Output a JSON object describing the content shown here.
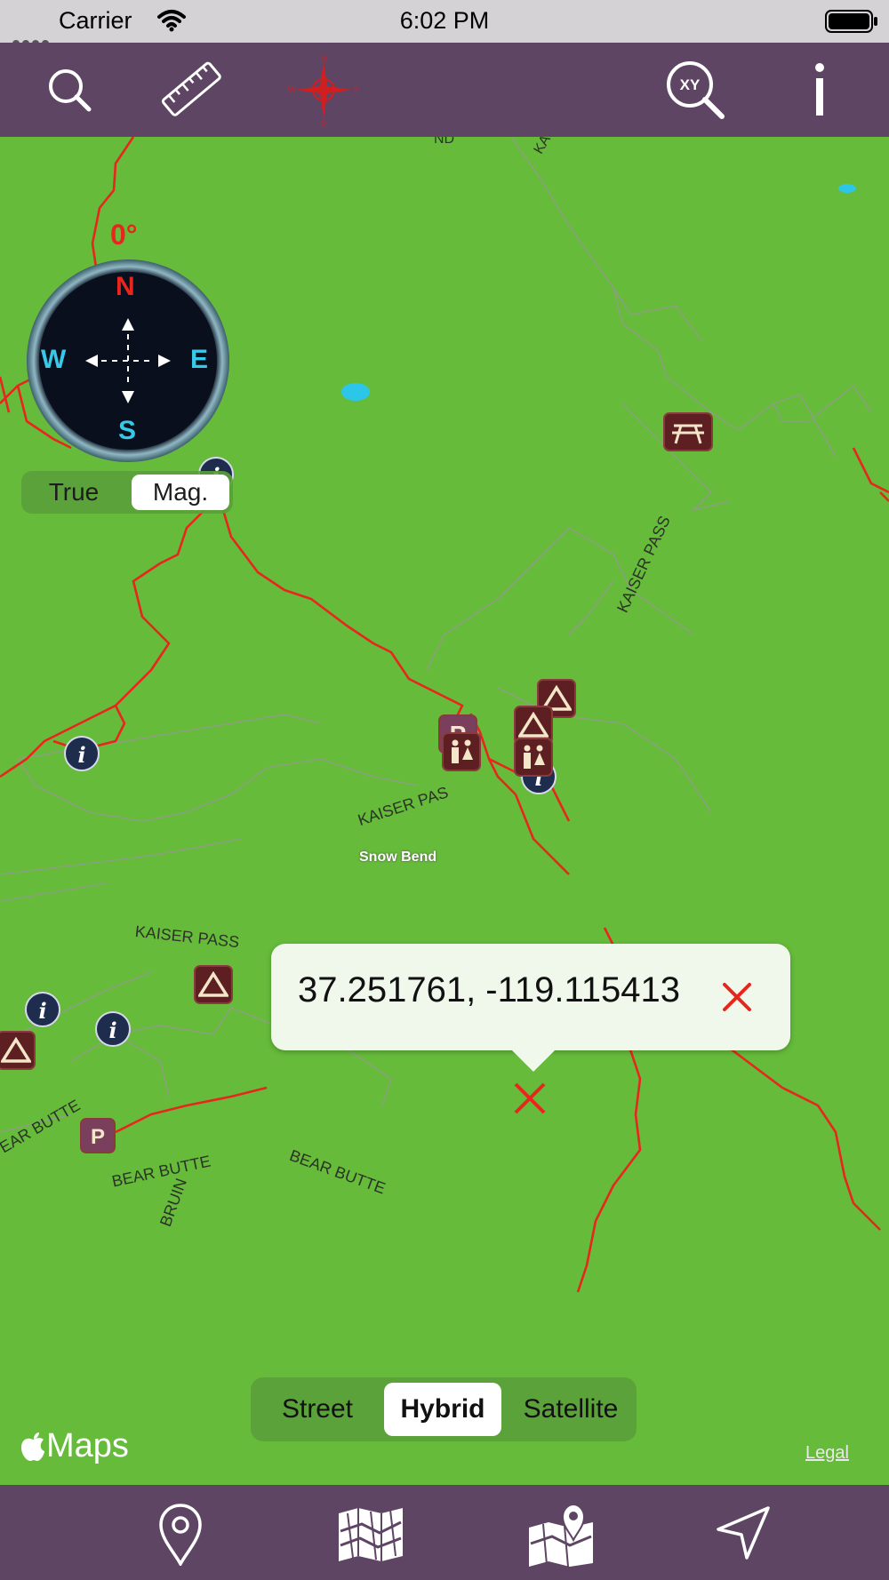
{
  "status_bar": {
    "carrier": "Carrier",
    "time": "6:02 PM",
    "icons": [
      "signal-dots-icon",
      "wifi-icon",
      "battery-icon"
    ]
  },
  "toolbar": {
    "items": [
      {
        "name": "search",
        "icon": "search-icon"
      },
      {
        "name": "ruler",
        "icon": "ruler-icon"
      },
      {
        "name": "compass-rose",
        "icon": "compass-rose-icon"
      },
      {
        "name": "xy-search",
        "icon": "xy-search-icon"
      },
      {
        "name": "info",
        "icon": "info-icon"
      }
    ]
  },
  "compass": {
    "degree": "0°",
    "north": "N",
    "south": "S",
    "east": "E",
    "west": "W",
    "toggle": {
      "options": [
        "True",
        "Mag."
      ],
      "selected": "Mag."
    }
  },
  "map": {
    "labels": {
      "kaiser_pass_1": "KAISER PASS",
      "kaiser_pass_2": "KAISER PASS",
      "kaiser_pass_3": "KAISER PAS",
      "snow_bend": "Snow Bend",
      "bear_butte_1": "BEAR BUTTE",
      "bear_butte_2": "BEAR BUTTE",
      "bear_butte_3": "EAR BUTTE",
      "bruin": "BRUIN",
      "top_fragment_1": "ND",
      "top_fragment_2": "KA"
    }
  },
  "callout": {
    "coordinates": "37.251761, -119.115413"
  },
  "map_type": {
    "options": [
      "Street",
      "Hybrid",
      "Satellite"
    ],
    "selected": "Hybrid"
  },
  "attribution": {
    "brand": "Maps",
    "legal": "Legal"
  },
  "tabbar": {
    "items": [
      {
        "name": "location-pin",
        "icon": "location-pin-icon"
      },
      {
        "name": "folded-map",
        "icon": "folded-map-icon"
      },
      {
        "name": "map-with-pin",
        "icon": "map-with-pin-icon"
      },
      {
        "name": "navigate",
        "icon": "navigate-arrow-icon"
      }
    ]
  },
  "colors": {
    "toolbar_bg": "#5e4564",
    "map_bg": "#66bb3a",
    "trail_red": "#e8261d",
    "road_gray": "#8b9a80",
    "poi_maroon": "#5e1f22",
    "compass_cardinal_ns": "#e8261d",
    "compass_cardinal_ew": "#36c9e8"
  }
}
